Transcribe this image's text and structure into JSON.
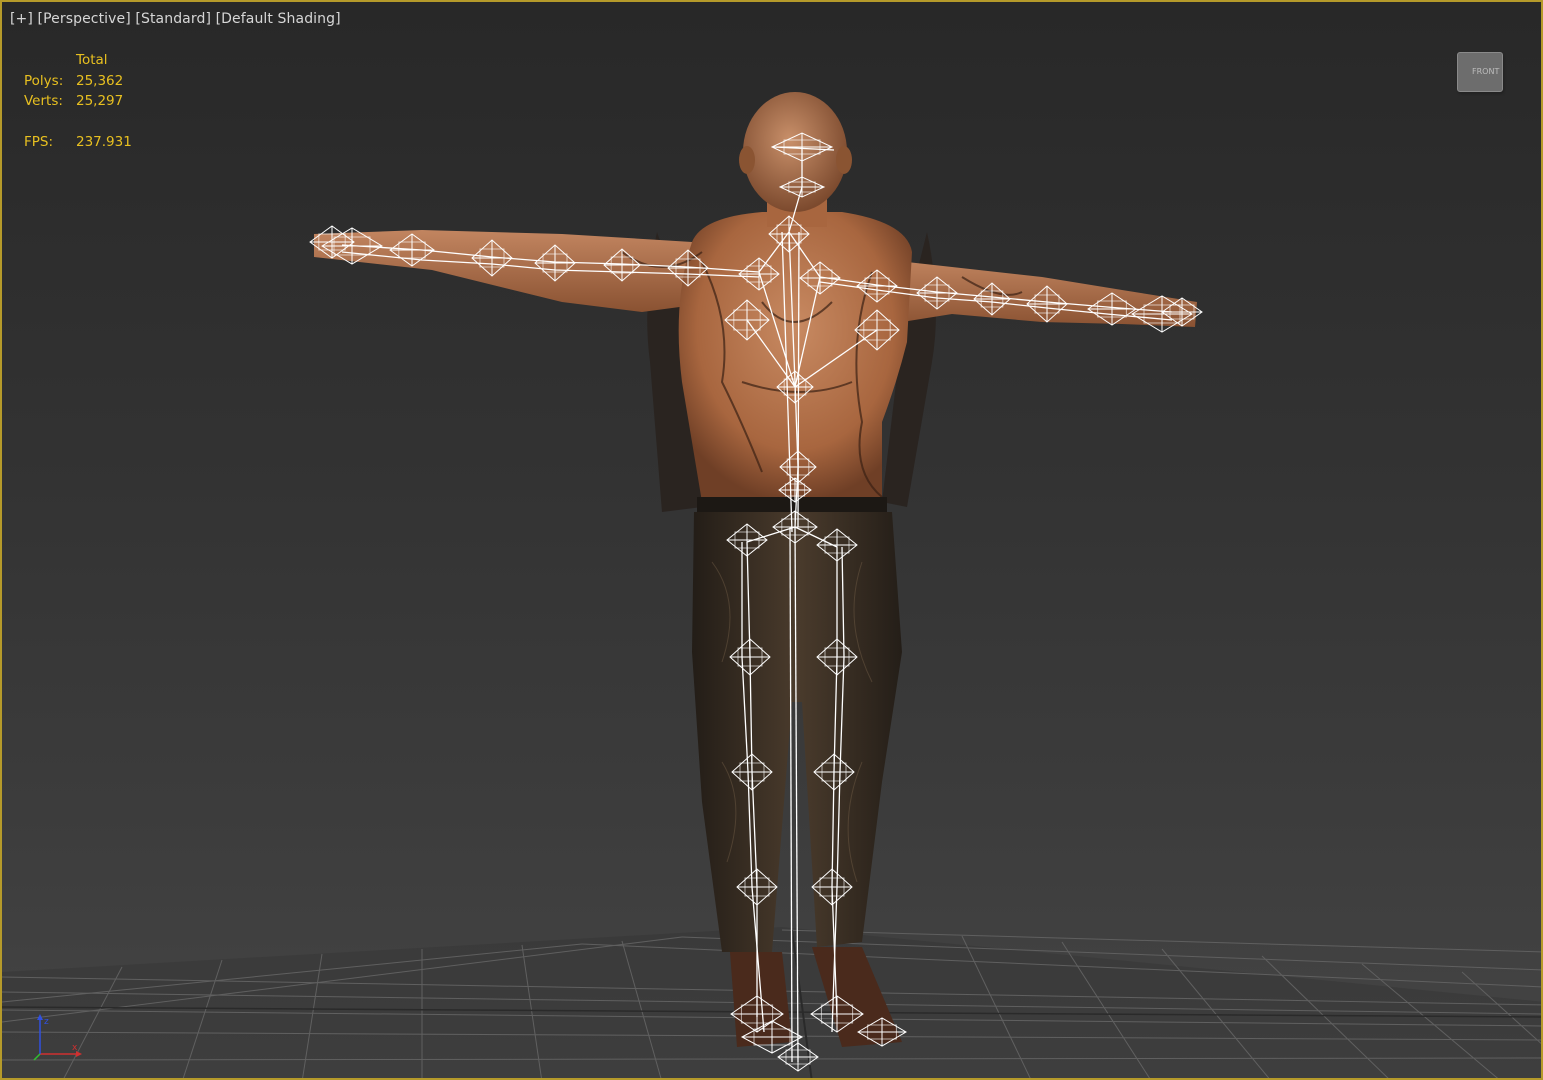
{
  "viewport": {
    "label_parts": [
      "[+]",
      "[Perspective]",
      "[Standard]",
      "[Default Shading]"
    ]
  },
  "stats": {
    "header": "Total",
    "rows": [
      {
        "key": "Polys:",
        "value": "25,362"
      },
      {
        "key": "Verts:",
        "value": "25,297"
      }
    ],
    "fps_key": "FPS:",
    "fps_value": "237.931"
  },
  "viewcube": {
    "face": "FRONT",
    "icon": "viewcube-icon"
  },
  "axis_gizmo": {
    "icon": "axis-gizmo-icon",
    "axes": [
      "x",
      "y",
      "z"
    ]
  },
  "colors": {
    "border_active": "#b59a2a",
    "stats_text": "#e8c020",
    "label_text": "#d6d6d6",
    "bone_wire": "#ffffff",
    "skin": "#b0714d",
    "jeans": "#3a3026"
  }
}
